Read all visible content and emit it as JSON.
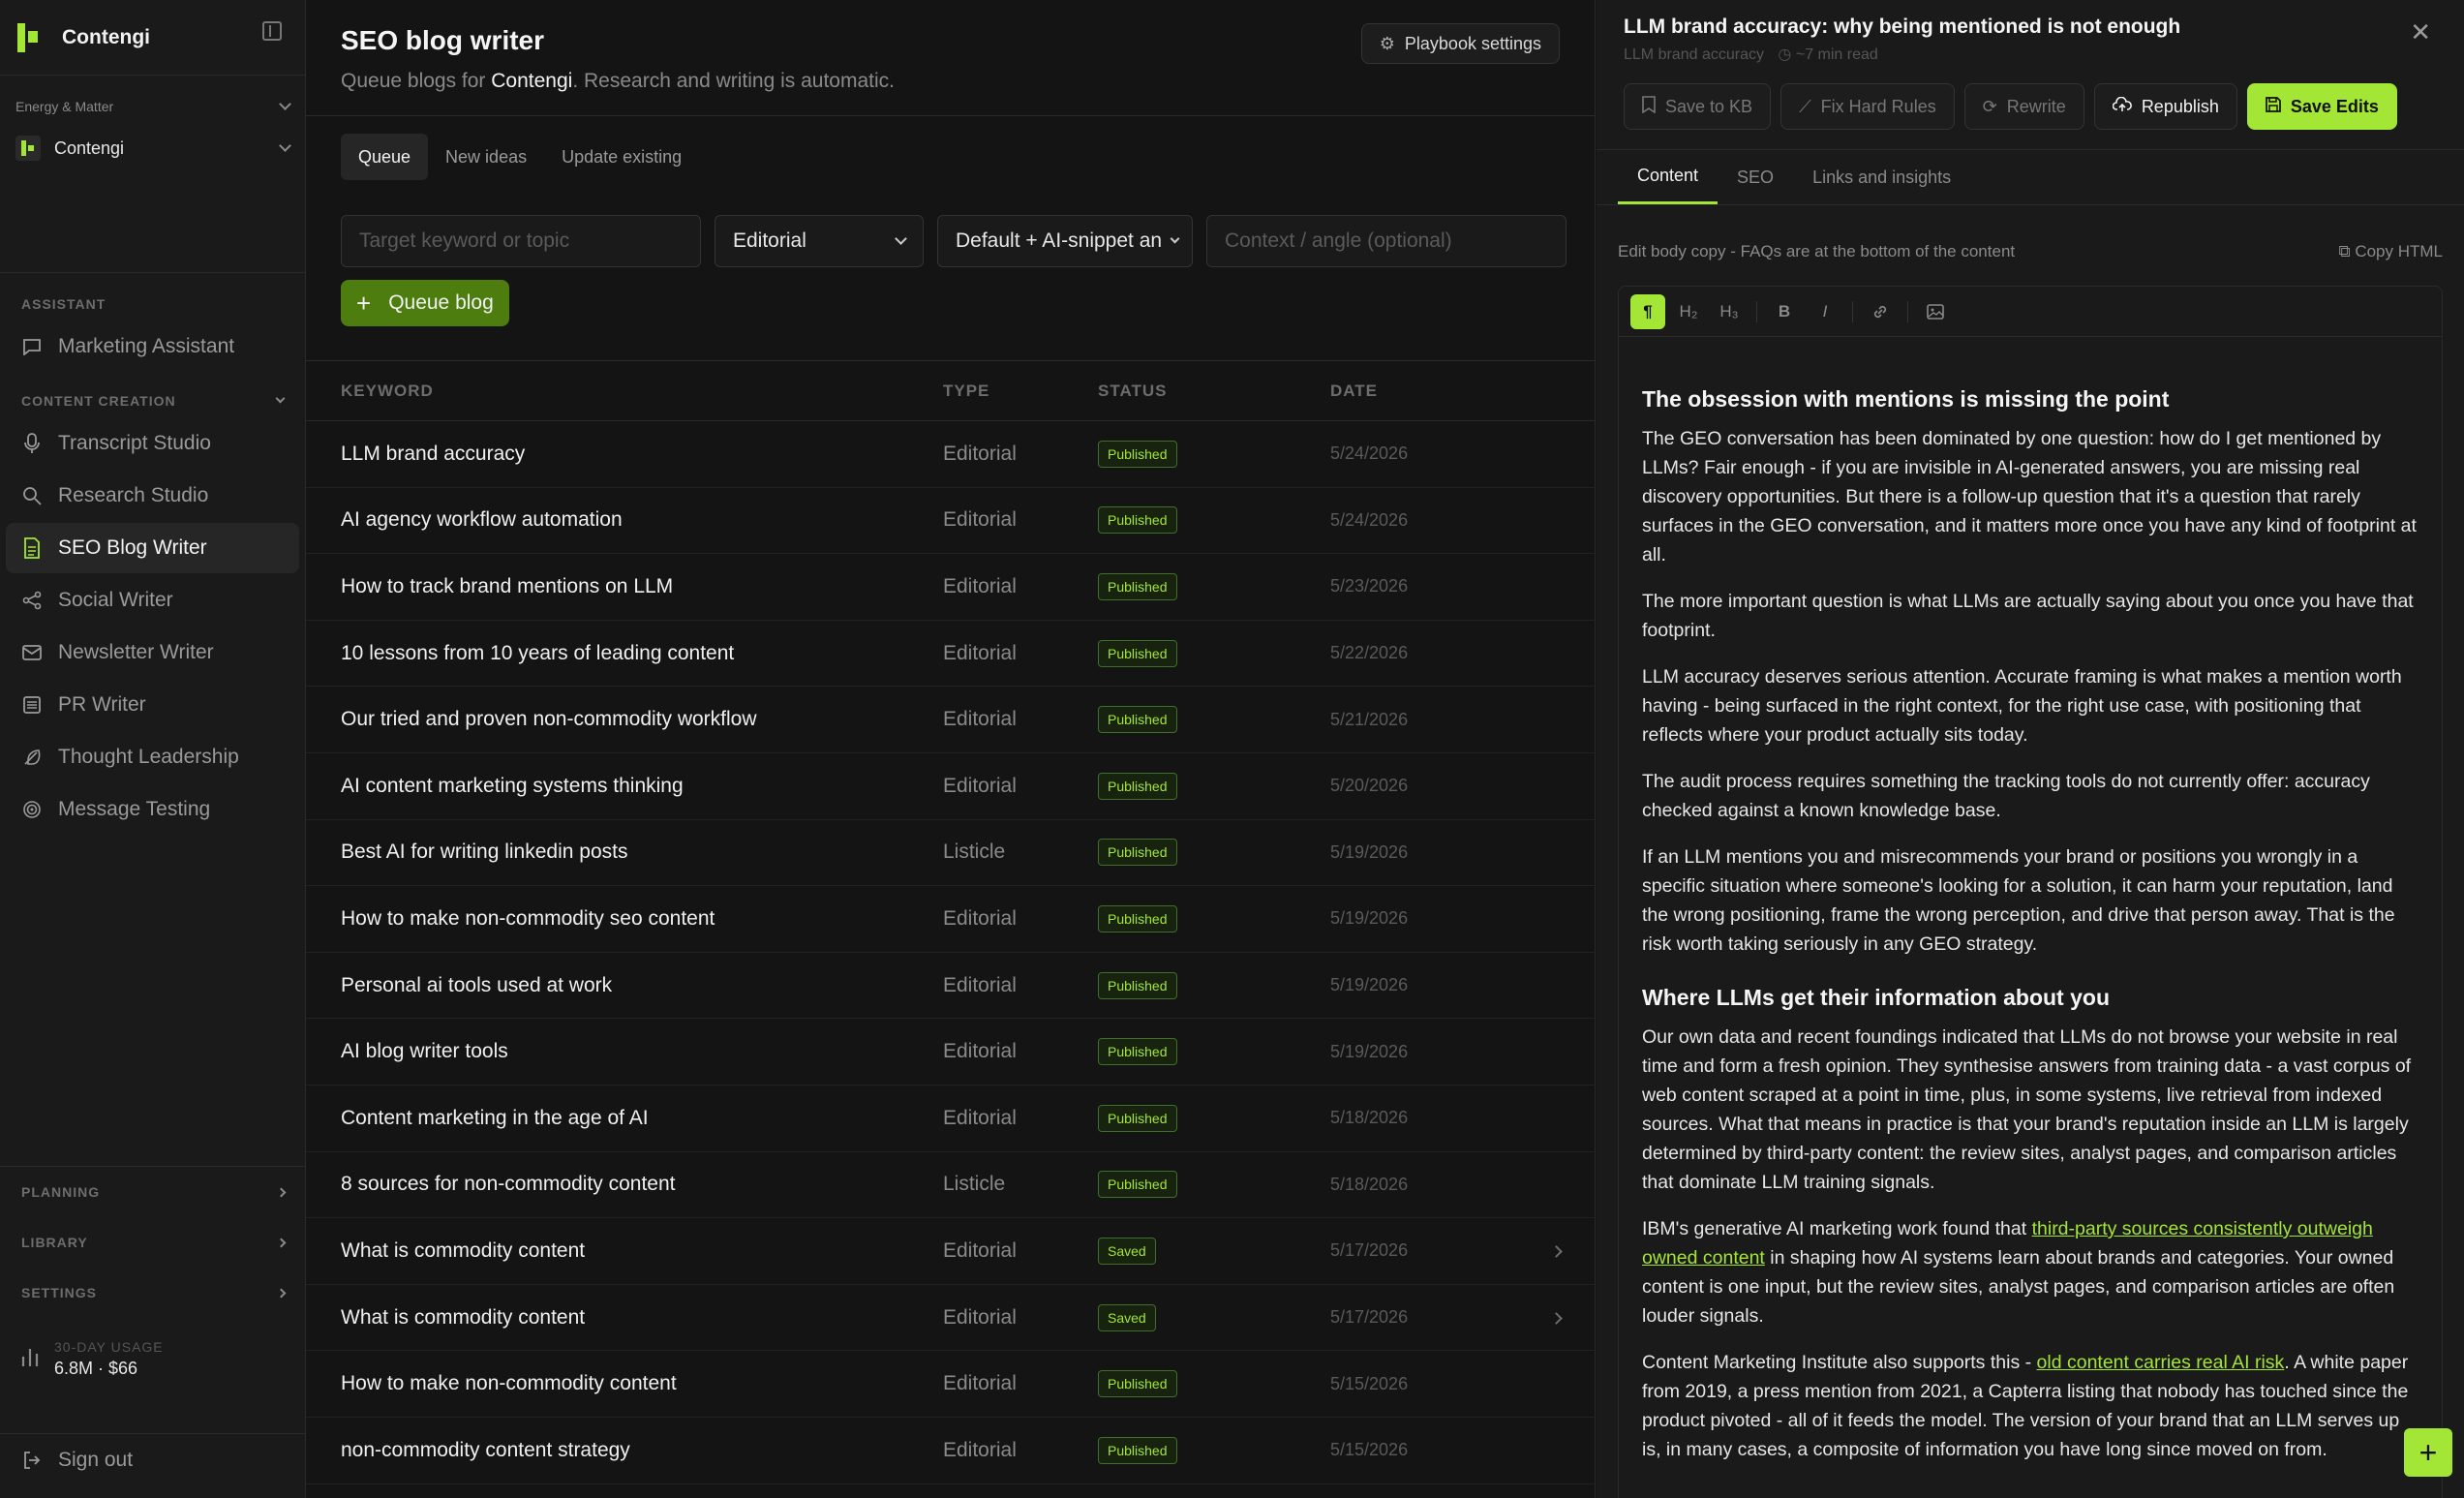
{
  "sidebar": {
    "brand": "Contengi",
    "org": "Energy & Matter",
    "workspace": "Contengi",
    "assistant_heading": "ASSISTANT",
    "assistant_item": "Marketing Assistant",
    "content_heading": "CONTENT CREATION",
    "items": [
      {
        "label": "Transcript Studio",
        "icon": "mic-icon"
      },
      {
        "label": "Research Studio",
        "icon": "search-icon"
      },
      {
        "label": "SEO Blog Writer",
        "icon": "document-icon"
      },
      {
        "label": "Social Writer",
        "icon": "share-icon"
      },
      {
        "label": "Newsletter Writer",
        "icon": "mail-icon"
      },
      {
        "label": "PR Writer",
        "icon": "newspaper-icon"
      },
      {
        "label": "Thought Leadership",
        "icon": "feather-icon"
      },
      {
        "label": "Message Testing",
        "icon": "target-icon"
      }
    ],
    "planning": "PLANNING",
    "library": "LIBRARY",
    "settings": "SETTINGS",
    "usage_label": "30-DAY USAGE",
    "usage_value": "6.8M · $66",
    "sign_out": "Sign out"
  },
  "main": {
    "title": "SEO blog writer",
    "subtitle_pre": "Queue blogs for ",
    "subtitle_brand": "Contengi",
    "subtitle_post": ". Research and writing is automatic.",
    "playbook_button": "Playbook settings",
    "tabs": [
      "Queue",
      "New ideas",
      "Update existing"
    ],
    "keyword_placeholder": "Target keyword or topic",
    "type_select": "Editorial",
    "format_select": "Default + AI-snippet an",
    "context_placeholder": "Context / angle (optional)",
    "queue_button": "Queue blog",
    "columns": [
      "KEYWORD",
      "TYPE",
      "STATUS",
      "DATE"
    ],
    "rows": [
      {
        "keyword": "LLM brand accuracy",
        "type": "Editorial",
        "status": "Published",
        "date": "5/24/2026"
      },
      {
        "keyword": "AI agency workflow automation",
        "type": "Editorial",
        "status": "Published",
        "date": "5/24/2026"
      },
      {
        "keyword": "How to track brand mentions on LLM",
        "type": "Editorial",
        "status": "Published",
        "date": "5/23/2026"
      },
      {
        "keyword": "10 lessons from 10 years of leading content",
        "type": "Editorial",
        "status": "Published",
        "date": "5/22/2026"
      },
      {
        "keyword": "Our tried and proven non-commodity workflow",
        "type": "Editorial",
        "status": "Published",
        "date": "5/21/2026"
      },
      {
        "keyword": "AI content marketing systems thinking",
        "type": "Editorial",
        "status": "Published",
        "date": "5/20/2026"
      },
      {
        "keyword": "Best AI for writing linkedin posts",
        "type": "Listicle",
        "status": "Published",
        "date": "5/19/2026"
      },
      {
        "keyword": "How to make non-commodity seo content",
        "type": "Editorial",
        "status": "Published",
        "date": "5/19/2026"
      },
      {
        "keyword": "Personal ai tools used at work",
        "type": "Editorial",
        "status": "Published",
        "date": "5/19/2026"
      },
      {
        "keyword": "AI blog writer tools",
        "type": "Editorial",
        "status": "Published",
        "date": "5/19/2026"
      },
      {
        "keyword": "Content marketing in the age of AI",
        "type": "Editorial",
        "status": "Published",
        "date": "5/18/2026"
      },
      {
        "keyword": "8 sources for non-commodity content",
        "type": "Listicle",
        "status": "Published",
        "date": "5/18/2026"
      },
      {
        "keyword": "What is commodity content",
        "type": "Editorial",
        "status": "Saved",
        "date": "5/17/2026"
      },
      {
        "keyword": "What is commodity content",
        "type": "Editorial",
        "status": "Saved",
        "date": "5/17/2026"
      },
      {
        "keyword": "How to make non-commodity content",
        "type": "Editorial",
        "status": "Published",
        "date": "5/15/2026"
      },
      {
        "keyword": "non-commodity content strategy",
        "type": "Editorial",
        "status": "Published",
        "date": "5/15/2026"
      }
    ]
  },
  "panel": {
    "title": "LLM brand accuracy: why being mentioned is not enough",
    "meta_keyword": "LLM brand accuracy",
    "meta_read": "~7 min read",
    "actions": {
      "save_kb": "Save to KB",
      "fix_rules": "Fix Hard Rules",
      "rewrite": "Rewrite",
      "republish": "Republish",
      "save_edits": "Save Edits"
    },
    "tabs": [
      "Content",
      "SEO",
      "Links and insights"
    ],
    "edit_hint": "Edit body copy - FAQs are at the bottom of the content",
    "copy_html": "Copy HTML",
    "toolbar": {
      "p": "¶",
      "h2": "H₂",
      "h3": "H₃",
      "bold": "B",
      "italic": "I",
      "link": "🔗",
      "image": "▣"
    },
    "h1": "The obsession with mentions is missing the point",
    "p1": "The GEO conversation has been dominated by one question: how do I get mentioned by LLMs? Fair enough - if you are invisible in AI-generated answers, you are missing real discovery opportunities. But there is a follow-up question that it's a question that rarely surfaces in the GEO conversation, and it matters more once you have any kind of footprint at all.",
    "p2": "The more important question is what LLMs are actually saying about you once you have that footprint.",
    "p3": "LLM accuracy deserves serious attention. Accurate framing is what makes a mention worth having - being surfaced in the right context, for the right use case, with positioning that reflects where your product actually sits today.",
    "p4": "The audit process requires something the tracking tools do not currently offer: accuracy checked against a known knowledge base.",
    "p5": "If an LLM mentions you and misrecommends your brand or positions you wrongly in a specific situation where someone's looking for a solution, it can harm your reputation, land the wrong positioning, frame the wrong perception, and drive that person away. That is the risk worth taking seriously in any GEO strategy.",
    "h2": "Where LLMs get their information about you",
    "p6": "Our own data and recent foundings indicated that LLMs do not browse your website in real time and form a fresh opinion. They synthesise answers from training data - a vast corpus of web content scraped at a point in time, plus, in some systems, live retrieval from indexed sources. What that means in practice is that your brand's reputation inside an LLM is largely determined by third-party content: the review sites, analyst pages, and comparison articles that dominate LLM training signals.",
    "p7_pre": "IBM's generative AI marketing work found that ",
    "p7_link": "third-party sources consistently outweigh owned content",
    "p7_post": " in shaping how AI systems learn about brands and categories. Your owned content is one input, but the review sites, analyst pages, and comparison articles are often louder signals.",
    "p8_pre": "Content Marketing Institute also supports this - ",
    "p8_link": "old content carries real AI risk",
    "p8_post": ". A white paper from 2019, a press mention from 2021, a Capterra listing that nobody has touched since the product pivoted - all of it feeds the model. The version of your brand that an LLM serves up is, in many cases, a composite of information you have long since moved on from."
  }
}
